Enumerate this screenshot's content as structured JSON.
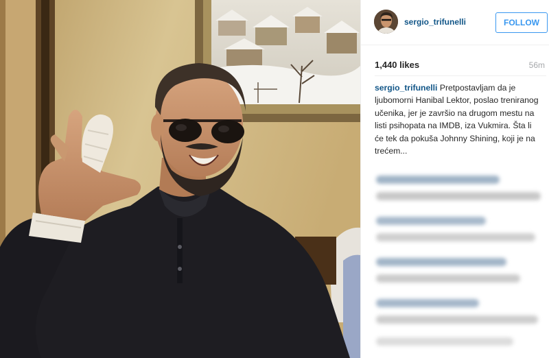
{
  "post": {
    "username": "sergio_trifunelli",
    "follow_label": "FOLLOW",
    "likes": "1,440 likes",
    "time": "56m",
    "caption_username": "sergio_trifunelli",
    "caption_text": " Pretpostavljam da je ljubomorni Hanibal Lektor, poslao treniranog učenika, jer je završio na drugom mestu na listi psihopata na IMDB, iza Vukmira. Šta li će tek da pokuša Johnny Shining, koji je na trećem..."
  },
  "colors": {
    "username": "#125688",
    "follow_border": "#3897f0",
    "timestamp": "#a5a7aa",
    "text": "#262626"
  }
}
